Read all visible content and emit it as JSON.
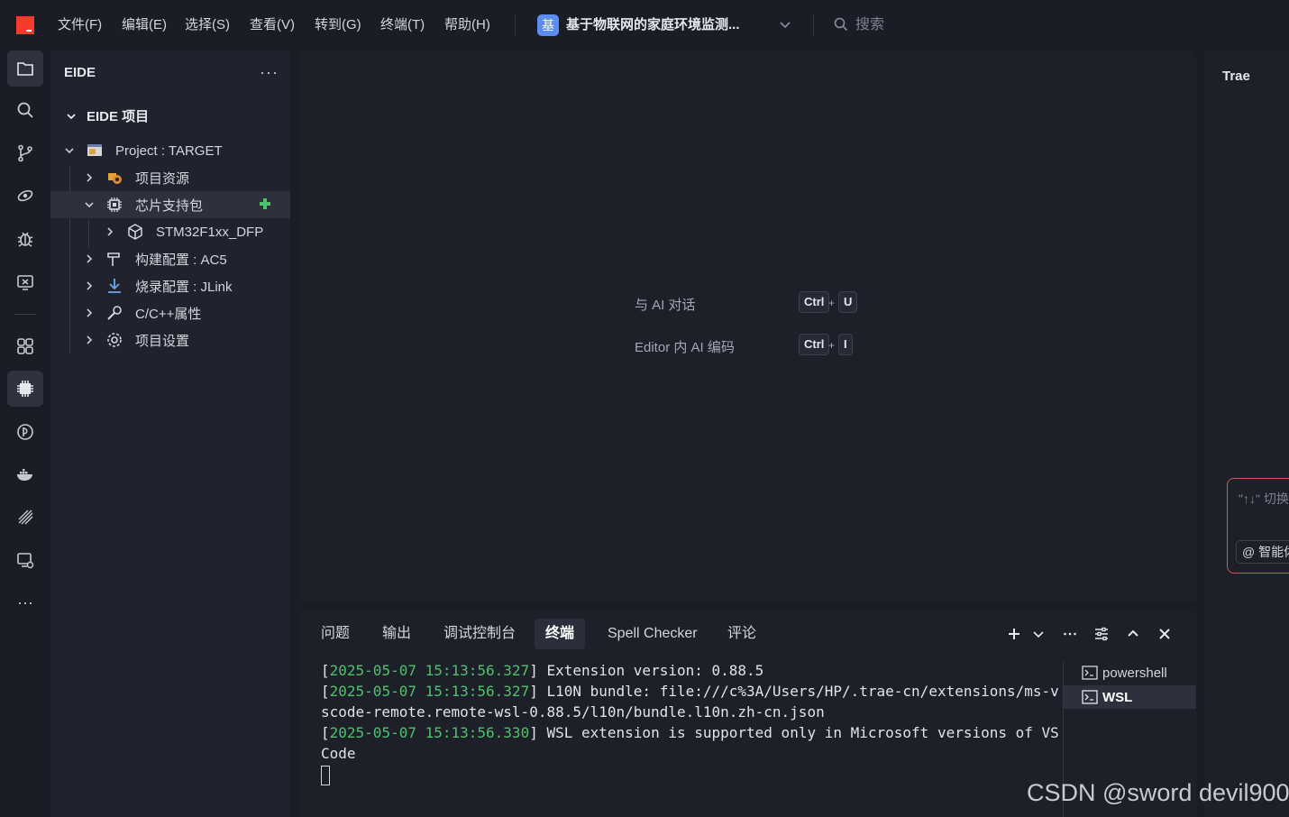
{
  "menu": {
    "items": [
      "文件(F)",
      "编辑(E)",
      "选择(S)",
      "查看(V)",
      "转到(G)",
      "终端(T)",
      "帮助(H)"
    ],
    "project_badge": "基",
    "project_title": "基于物联网的家庭环境监测...",
    "search_placeholder": "搜索"
  },
  "activity_bar": {
    "icons": [
      "explorer-icon",
      "search-icon",
      "source-control-icon",
      "remote-icon",
      "debug-icon",
      "remote-explorer-icon",
      "extensions-icon",
      "eide-chip-icon",
      "platformio-icon",
      "docker-icon",
      "flash-icon",
      "remote-monitor-icon",
      "more-icon"
    ],
    "more_label": "···"
  },
  "sidebar": {
    "title": "EIDE",
    "more": "···",
    "section": "EIDE 项目",
    "tree": [
      {
        "label": "Project : TARGET"
      },
      {
        "label": "项目资源"
      },
      {
        "label": "芯片支持包"
      },
      {
        "label": "STM32F1xx_DFP"
      },
      {
        "label": "构建配置 : AC5"
      },
      {
        "label": "烧录配置 : JLink"
      },
      {
        "label": "C/C++属性"
      },
      {
        "label": "项目设置"
      }
    ]
  },
  "editor": {
    "hints": [
      {
        "label": "与 AI 对话",
        "key1": "Ctrl",
        "plus": "+",
        "key2": "U"
      },
      {
        "label": "Editor 内 AI 编码",
        "key1": "Ctrl",
        "plus": "+",
        "key2": "I"
      }
    ]
  },
  "right_panel": {
    "title": "Trae",
    "chat_hint": "\"↑↓\" 切换",
    "chat_chip": "@ 智能体"
  },
  "panel": {
    "tabs": [
      "问题",
      "输出",
      "调试控制台",
      "终端",
      "Spell Checker",
      "评论"
    ],
    "active_tab": "终端",
    "terminal_lines": [
      {
        "ts": "2025-05-07 15:13:56.327",
        "text": "Extension version: 0.88.5"
      },
      {
        "ts": "2025-05-07 15:13:56.327",
        "text": "L10N bundle: file:///c%3A/Users/HP/.trae-cn/extensions/ms-vscode-remote.remote-wsl-0.88.5/l10n/bundle.l10n.zh-cn.json"
      },
      {
        "ts": "2025-05-07 15:13:56.330",
        "text": "WSL extension is supported only in Microsoft versions of VS Code"
      }
    ],
    "terminals": [
      {
        "name": "powershell"
      },
      {
        "name": "WSL"
      }
    ]
  },
  "watermark": "CSDN @sword devil900",
  "colors": {
    "brand": "#f53b2a",
    "accent": "#5b8def",
    "timestamp": "#4ec26a",
    "add_icon": "#4ec26a",
    "chat_border": "#d9534f"
  }
}
